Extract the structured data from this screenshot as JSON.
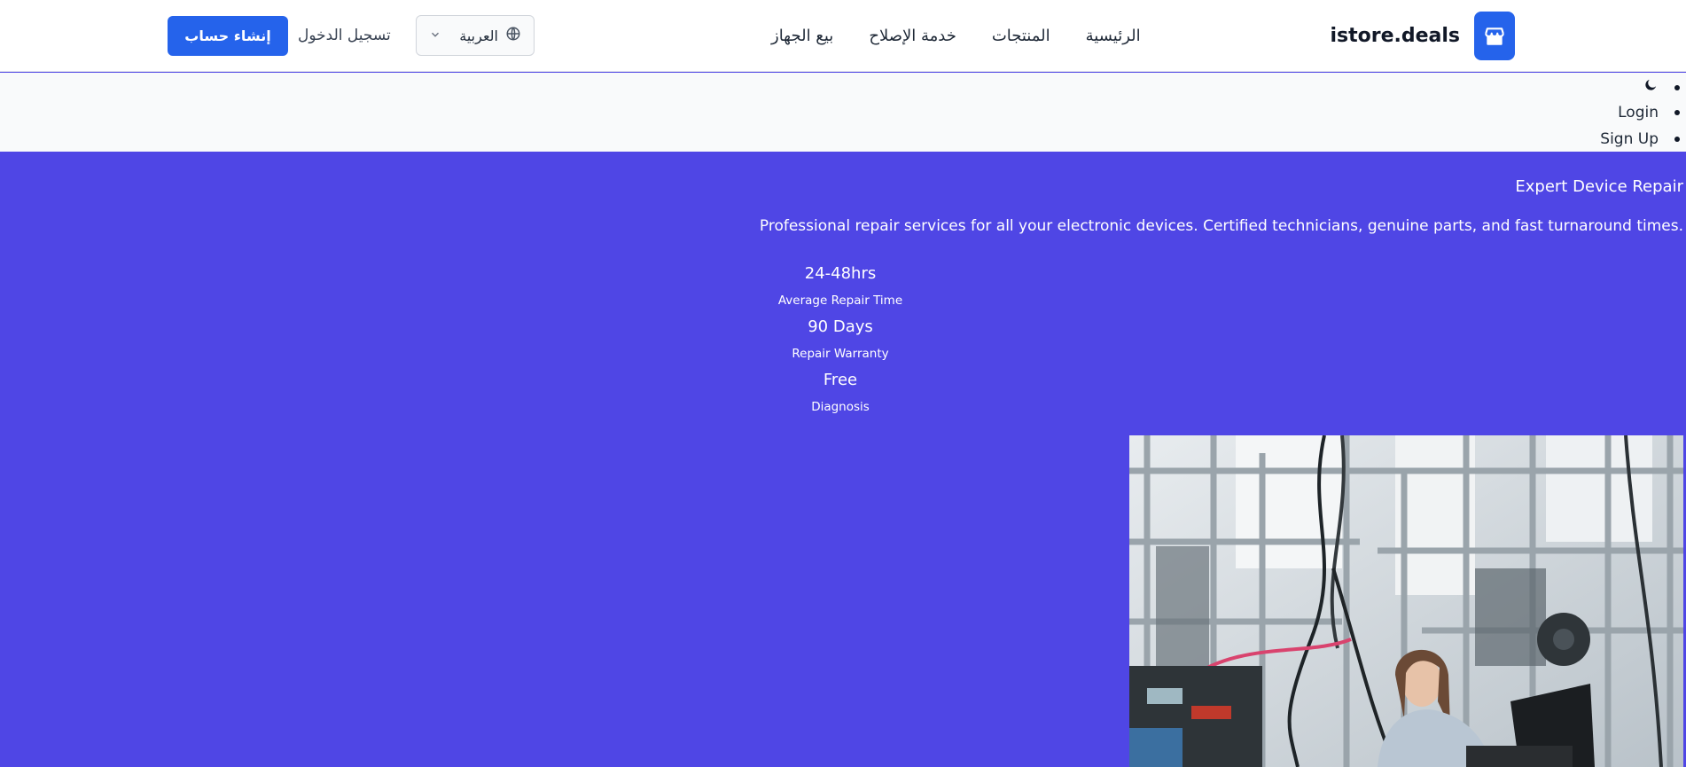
{
  "header": {
    "brand_name": "istore.deals",
    "nav": [
      "الرئيسية",
      "المنتجات",
      "خدمة الإصلاح",
      "بيع الجهاز"
    ],
    "language": "العربية",
    "login_label": "تسجيل الدخول",
    "signup_label": "إنشاء حساب"
  },
  "top_list": {
    "items": [
      "Login",
      "Sign Up"
    ]
  },
  "hero": {
    "title": "Expert Device Repair",
    "description": "Professional repair services for all your electronic devices. Certified technicians, genuine parts, and fast turnaround times.",
    "stats": [
      {
        "value": "24-48hrs",
        "label": "Average Repair Time"
      },
      {
        "value": "90 Days",
        "label": "Repair Warranty"
      },
      {
        "value": "Free",
        "label": "Diagnosis"
      }
    ]
  },
  "colors": {
    "primary": "#2563eb",
    "hero_background": "#4f46e5",
    "header_background": "#ffffff"
  },
  "icons": [
    "store-icon",
    "globe-icon",
    "chevron-down-icon",
    "moon-icon"
  ]
}
